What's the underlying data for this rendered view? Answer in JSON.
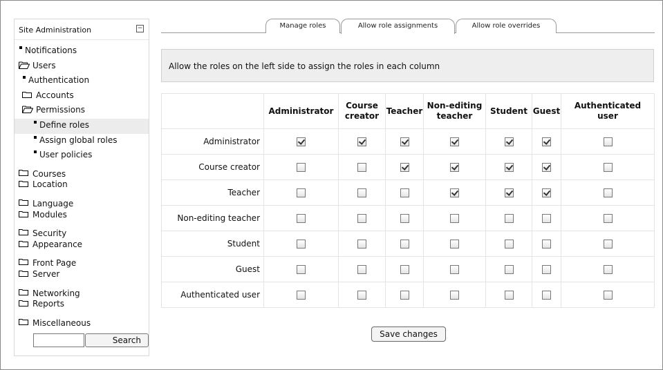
{
  "sidebar": {
    "title": "Site Administration",
    "collapse_symbol": "−",
    "items": [
      {
        "label": "Notifications",
        "icon": "bullet",
        "indent": 0
      },
      {
        "label": "Users",
        "icon": "folder-open",
        "indent": 0
      },
      {
        "label": "Authentication",
        "icon": "bullet",
        "indent": 1
      },
      {
        "label": "Accounts",
        "icon": "folder",
        "indent": 1
      },
      {
        "label": "Permissions",
        "icon": "folder-open",
        "indent": 1
      },
      {
        "label": "Define roles",
        "icon": "bullet",
        "indent": 2,
        "selected": true
      },
      {
        "label": "Assign global roles",
        "icon": "bullet",
        "indent": 2
      },
      {
        "label": "User policies",
        "icon": "bullet",
        "indent": 2
      },
      {
        "label": "Courses",
        "icon": "folder",
        "indent": 0
      },
      {
        "label": "Location",
        "icon": "folder",
        "indent": 0
      },
      {
        "label": "Language",
        "icon": "folder",
        "indent": 0
      },
      {
        "label": "Modules",
        "icon": "folder",
        "indent": 0
      },
      {
        "label": "Security",
        "icon": "folder",
        "indent": 0
      },
      {
        "label": "Appearance",
        "icon": "folder",
        "indent": 0
      },
      {
        "label": "Front Page",
        "icon": "folder",
        "indent": 0
      },
      {
        "label": "Server",
        "icon": "folder",
        "indent": 0
      },
      {
        "label": "Networking",
        "icon": "folder",
        "indent": 0
      },
      {
        "label": "Reports",
        "icon": "folder",
        "indent": 0
      },
      {
        "label": "Miscellaneous",
        "icon": "folder",
        "indent": 0
      }
    ],
    "search": {
      "value": "",
      "button_label": "Search"
    }
  },
  "tabs": [
    {
      "label": "Manage roles",
      "active": false
    },
    {
      "label": "Allow role assignments",
      "active": true
    },
    {
      "label": "Allow role overrides",
      "active": false
    }
  ],
  "notice": "Allow the roles on the left side to assign the roles in each column",
  "table": {
    "columns": [
      "Administrator",
      "Course creator",
      "Teacher",
      "Non-editing teacher",
      "Student",
      "Guest",
      "Authenticated user"
    ],
    "column_headers_display": [
      [
        "Administrator"
      ],
      [
        "Course",
        "creator"
      ],
      [
        "Teacher"
      ],
      [
        "Non-editing",
        "teacher"
      ],
      [
        "Student"
      ],
      [
        "Guest"
      ],
      [
        "Authenticated",
        "user"
      ]
    ],
    "rows": [
      {
        "role": "Administrator",
        "checks": [
          true,
          true,
          true,
          true,
          true,
          true,
          false
        ]
      },
      {
        "role": "Course creator",
        "checks": [
          false,
          false,
          true,
          true,
          true,
          true,
          false
        ]
      },
      {
        "role": "Teacher",
        "checks": [
          false,
          false,
          false,
          true,
          true,
          true,
          false
        ]
      },
      {
        "role": "Non-editing teacher",
        "checks": [
          false,
          false,
          false,
          false,
          false,
          false,
          false
        ]
      },
      {
        "role": "Student",
        "checks": [
          false,
          false,
          false,
          false,
          false,
          false,
          false
        ]
      },
      {
        "role": "Guest",
        "checks": [
          false,
          false,
          false,
          false,
          false,
          false,
          false
        ]
      },
      {
        "role": "Authenticated user",
        "checks": [
          false,
          false,
          false,
          false,
          false,
          false,
          false
        ]
      }
    ]
  },
  "save_button_label": "Save changes"
}
